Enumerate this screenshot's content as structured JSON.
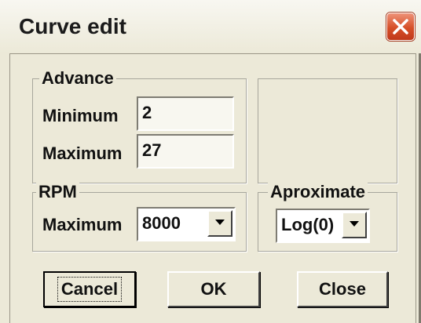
{
  "window": {
    "title": "Curve edit",
    "close_icon": "close-x-icon",
    "colors": {
      "face": "#ece9d8",
      "close_button": "#d64f28"
    }
  },
  "advance": {
    "legend": "Advance",
    "minimum_label": "Minimum",
    "minimum_value": "2",
    "maximum_label": "Maximum",
    "maximum_value": "27"
  },
  "rpm": {
    "legend": "RPM",
    "maximum_label": "Maximum",
    "maximum_value": "8000"
  },
  "aproximate": {
    "legend": "Aproximate",
    "value": "Log(0)"
  },
  "buttons": {
    "cancel": "Cancel",
    "ok": "OK",
    "close": "Close"
  }
}
